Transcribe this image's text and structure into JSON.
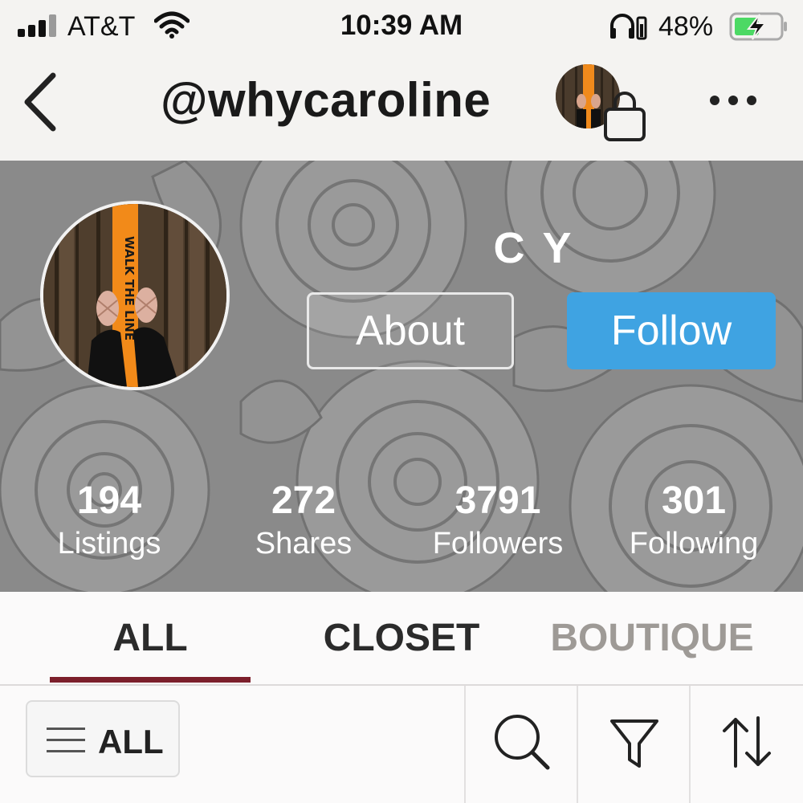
{
  "status_bar": {
    "carrier": "AT&T",
    "time": "10:39 AM",
    "battery_percent": "48%",
    "battery_level": 0.48,
    "charging": true,
    "icons": [
      "signal-icon",
      "wifi-icon",
      "headphone-battery-icon",
      "battery-charging-icon"
    ]
  },
  "nav": {
    "title": "@whycaroline",
    "icons": [
      "back-chevron-icon",
      "shopping-bag-icon",
      "more-dots-icon"
    ]
  },
  "profile": {
    "display_name": "C Y",
    "avatar_text": "WALK THE LINE",
    "about_label": "About",
    "follow_label": "Follow",
    "follow_color": "#3fa3e2",
    "stats": [
      {
        "value": "194",
        "label": "Listings"
      },
      {
        "value": "272",
        "label": "Shares"
      },
      {
        "value": "3791",
        "label": "Followers"
      },
      {
        "value": "301",
        "label": "Following"
      }
    ]
  },
  "tabs": {
    "items": [
      {
        "label": "ALL",
        "active": true
      },
      {
        "label": "CLOSET",
        "active": false
      },
      {
        "label": "BOUTIQUE",
        "active": false,
        "muted": true
      }
    ],
    "active_color": "#7c1f2b",
    "text_color": "#2b2b2b",
    "muted_color": "#9e9a96"
  },
  "filter_bar": {
    "dropdown_label": "ALL",
    "icons": [
      "hamburger-icon",
      "search-icon",
      "filter-funnel-icon",
      "sort-arrows-icon"
    ]
  }
}
